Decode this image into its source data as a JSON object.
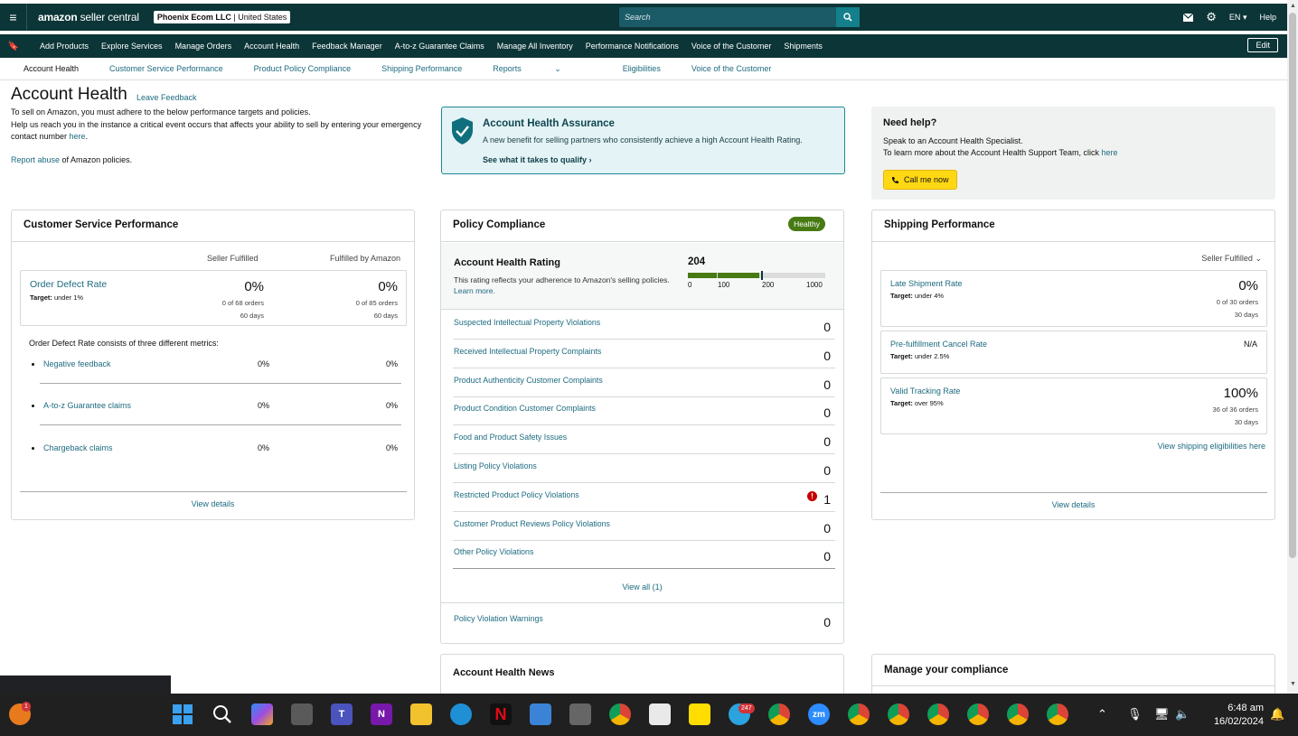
{
  "topbar": {
    "logo_brand": "amazon",
    "logo_sub": " seller central",
    "store_name": "Phoenix Ecom LLC",
    "store_country": " | United States",
    "search_placeholder": "Search",
    "lang": "EN",
    "help": "Help"
  },
  "nav": {
    "items": [
      "Add Products",
      "Explore Services",
      "Manage Orders",
      "Account Health",
      "Feedback Manager",
      "A-to-z Guarantee Claims",
      "Manage All Inventory",
      "Performance Notifications",
      "Voice of the Customer",
      "Shipments"
    ],
    "edit": "Edit"
  },
  "subnav": {
    "items": [
      "Account Health",
      "Customer Service Performance",
      "Product Policy Compliance",
      "Shipping Performance",
      "Reports",
      "Eligibilities",
      "Voice of the Customer"
    ],
    "reports_caret": "⌄"
  },
  "header": {
    "title": "Account Health",
    "leave_feedback": "Leave Feedback",
    "intro_1": "To sell on Amazon, you must adhere to the below performance targets and policies.",
    "intro_2": "Help us reach you in the instance a critical event occurs that affects your ability to sell by entering your emergency contact number ",
    "intro_here": "here",
    "intro_end": ".",
    "report_link": "Report abuse",
    "report_rest": " of Amazon policies."
  },
  "aha": {
    "title": "Account Health Assurance",
    "desc": "A new benefit for selling partners who consistently achieve a high Account Health Rating.",
    "link": "See what it takes to qualify"
  },
  "help": {
    "title": "Need help?",
    "line1": "Speak to an Account Health Specialist.",
    "line2": "To learn more about the Account Health Support Team, click ",
    "line2_link": "here",
    "call": "Call me now"
  },
  "csp": {
    "title": "Customer Service Performance",
    "col1": "Seller Fulfilled",
    "col2": "Fulfilled by Amazon",
    "odr_title": "Order Defect Rate",
    "odr_target_label": "Target:",
    "odr_target": " under 1%",
    "sf_value": "0%",
    "sf_orders": "0 of 68 orders",
    "sf_days": "60 days",
    "fba_value": "0%",
    "fba_orders": "0 of 85 orders",
    "fba_days": "60 days",
    "metric_intro": "Order Defect Rate consists of three different metrics:",
    "metrics": [
      {
        "label": "Negative feedback",
        "sf": "0%",
        "fba": "0%"
      },
      {
        "label": "A-to-z Guarantee claims",
        "sf": "0%",
        "fba": "0%"
      },
      {
        "label": "Chargeback claims",
        "sf": "0%",
        "fba": "0%"
      }
    ],
    "view_details": "View details"
  },
  "pc": {
    "title": "Policy Compliance",
    "status": "Healthy",
    "ahr_title": "Account Health Rating",
    "ahr_desc": "This rating reflects your adherence to Amazon's selling policies. ",
    "ahr_learn": "Learn more.",
    "score": "204",
    "score_value": 204,
    "ticks": [
      "0",
      "100",
      "200",
      "1000"
    ],
    "violations": [
      {
        "label": "Suspected Intellectual Property Violations",
        "count": "0"
      },
      {
        "label": "Received Intellectual Property Complaints",
        "count": "0"
      },
      {
        "label": "Product Authenticity Customer Complaints",
        "count": "0"
      },
      {
        "label": "Product Condition Customer Complaints",
        "count": "0"
      },
      {
        "label": "Food and Product Safety Issues",
        "count": "0"
      },
      {
        "label": "Listing Policy Violations",
        "count": "0"
      },
      {
        "label": "Restricted Product Policy Violations",
        "count": "1"
      },
      {
        "label": "Customer Product Reviews Policy Violations",
        "count": "0"
      },
      {
        "label": "Other Policy Violations",
        "count": "0"
      }
    ],
    "view_all": "View all (1)",
    "warnings_label": "Policy Violation Warnings",
    "warnings_count": "0"
  },
  "sp": {
    "title": "Shipping Performance",
    "filter": "Seller Fulfilled",
    "late_title": "Late Shipment Rate",
    "late_target": " under 4%",
    "late_value": "0%",
    "late_orders": "0 of 30 orders",
    "late_days": "30 days",
    "cancel_title": "Pre-fulfillment Cancel Rate",
    "cancel_target": " under 2.5%",
    "cancel_value": "N/A",
    "vtr_title": "Valid Tracking Rate",
    "vtr_target": " over 95%",
    "vtr_value": "100%",
    "vtr_orders": "36 of 36 orders",
    "vtr_days": "30 days",
    "target_label": "Target:",
    "elig_link": "View shipping eligibilities here",
    "view_details": "View details"
  },
  "news": {
    "title": "Account Health News"
  },
  "manage": {
    "title": "Manage your compliance"
  },
  "taskbar": {
    "time": "6:48 am",
    "date": "16/02/2024",
    "badge_weather": "1",
    "badge_telegram": "247"
  },
  "colors": {
    "header_bg": "#0c3537",
    "link": "#1d6b80",
    "healthy": "#487a14",
    "call_btn": "#ffd814"
  }
}
